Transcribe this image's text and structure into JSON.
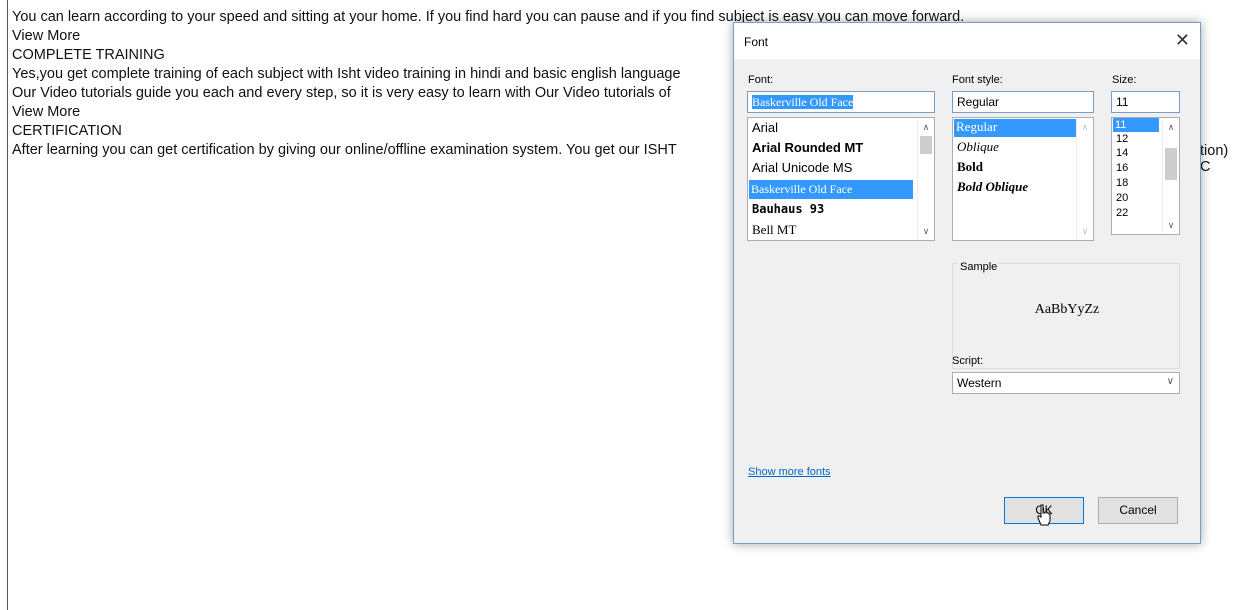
{
  "document": {
    "lines": [
      "You can learn according to your speed and sitting at your home. If you find hard you can pause and if you find subject is easy you can move forward.",
      "View More",
      "COMPLETE TRAINING",
      "Yes,you get complete training of each subject with Isht video training in hindi and basic english language",
      "Our Video tutorials guide you each and every step, so it is very easy to learn with Our Video tutorials of",
      "View More",
      "CERTIFICATION",
      "After learning you can get certification by giving our online/offline examination system. You get our ISHT"
    ],
    "clipped_right": "tion) C"
  },
  "dialog": {
    "title": "Font",
    "font_label": "Font:",
    "font_value": "Baskerville Old Face",
    "fonts": [
      "Arial",
      "Arial Rounded MT",
      "Arial Unicode MS",
      "Baskerville Old Face",
      "Bauhaus 93",
      "Bell MT"
    ],
    "style_label": "Font style:",
    "style_value": "Regular",
    "styles": [
      "Regular",
      "Oblique",
      "Bold",
      "Bold Oblique"
    ],
    "size_label": "Size:",
    "size_value": "11",
    "sizes": [
      "11",
      "12",
      "14",
      "16",
      "18",
      "20",
      "22"
    ],
    "sample_label": "Sample",
    "sample_text": "AaBbYyZz",
    "script_label": "Script:",
    "script_value": "Western",
    "show_more": "Show more fonts",
    "ok": "OK",
    "cancel": "Cancel"
  },
  "colors": {
    "selection": "#3399ff",
    "link": "#0066cc",
    "border": "#7a9cc6"
  }
}
